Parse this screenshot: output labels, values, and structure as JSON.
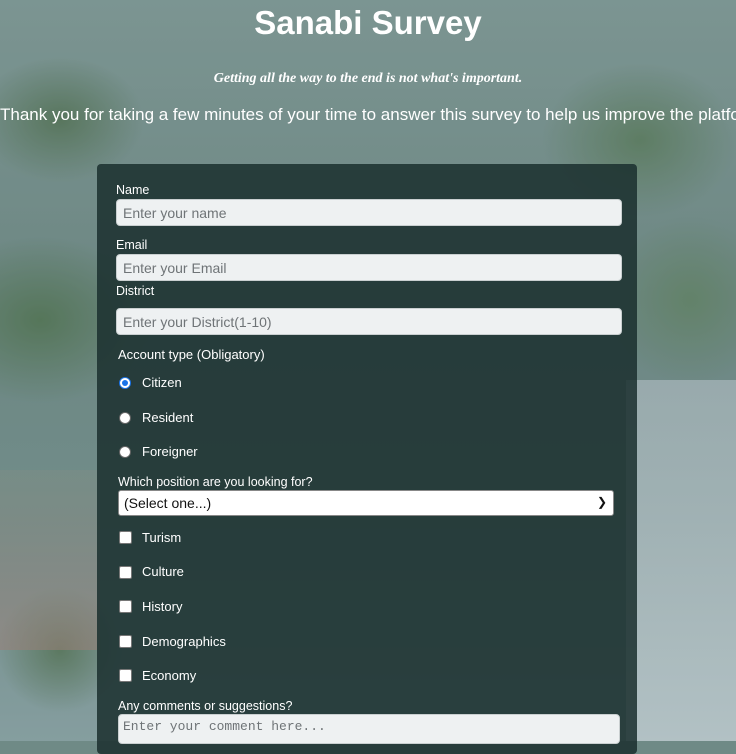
{
  "header": {
    "title": "Sanabi Survey",
    "tagline": "Getting all the way to the end is not what's important.",
    "intro": "Thank you for taking a few minutes of your time to answer this survey to help us improve the platform."
  },
  "form": {
    "name": {
      "label": "Name",
      "placeholder": "Enter your name"
    },
    "email": {
      "label": "Email",
      "placeholder": "Enter your Email"
    },
    "district": {
      "label": "District",
      "placeholder": "Enter your District(1-10)"
    },
    "account_type": {
      "label": "Account type (Obligatory)",
      "options": [
        "Citizen",
        "Resident",
        "Foreigner"
      ],
      "selected": "Citizen"
    },
    "position": {
      "label": "Which position are you looking for?",
      "selected": "(Select one...)"
    },
    "interests": [
      "Turism",
      "Culture",
      "History",
      "Demographics",
      "Economy"
    ],
    "comments": {
      "label": "Any comments or suggestions?",
      "placeholder": "Enter your comment here..."
    }
  },
  "colors": {
    "panel": "#1b302e",
    "accent": "#1a73e8",
    "text": "#ffffff"
  }
}
